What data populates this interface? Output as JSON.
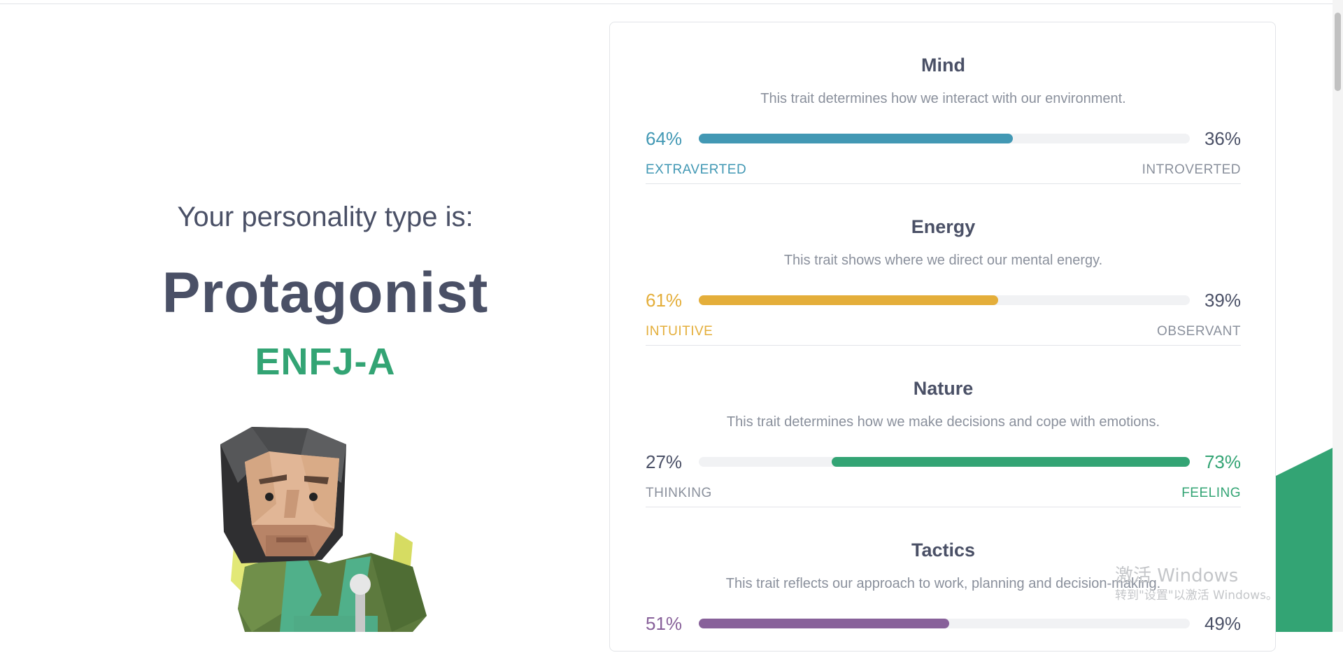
{
  "intro_text": "Your personality type is:",
  "type_name": "Protagonist",
  "type_code": "ENFJ-A",
  "traits": [
    {
      "title": "Mind",
      "description": "This trait determines how we interact with our environment.",
      "left_percent": "64%",
      "right_percent": "36%",
      "left_label": "EXTRAVERTED",
      "right_label": "INTROVERTED",
      "fill_fraction": 0.64,
      "fill_side": "left",
      "color": "#4298b4"
    },
    {
      "title": "Energy",
      "description": "This trait shows where we direct our mental energy.",
      "left_percent": "61%",
      "right_percent": "39%",
      "left_label": "INTUITIVE",
      "right_label": "OBSERVANT",
      "fill_fraction": 0.61,
      "fill_side": "left",
      "color": "#e4ae3a"
    },
    {
      "title": "Nature",
      "description": "This trait determines how we make decisions and cope with emotions.",
      "left_percent": "27%",
      "right_percent": "73%",
      "left_label": "THINKING",
      "right_label": "FEELING",
      "fill_fraction": 0.73,
      "fill_side": "right",
      "color": "#33a474"
    },
    {
      "title": "Tactics",
      "description": "This trait reflects our approach to work, planning and decision-making.",
      "left_percent": "51%",
      "right_percent": "49%",
      "left_label": "",
      "right_label": "",
      "fill_fraction": 0.51,
      "fill_side": "left",
      "color": "#88619a"
    }
  ],
  "watermark": {
    "line1": "激活 Windows",
    "line2": "转到\"设置\"以激活 Windows。"
  },
  "colors": {
    "text": "#4a5066",
    "muted": "#8a909c",
    "accent_green": "#33a474"
  },
  "illustration": "protagonist-character-icon"
}
